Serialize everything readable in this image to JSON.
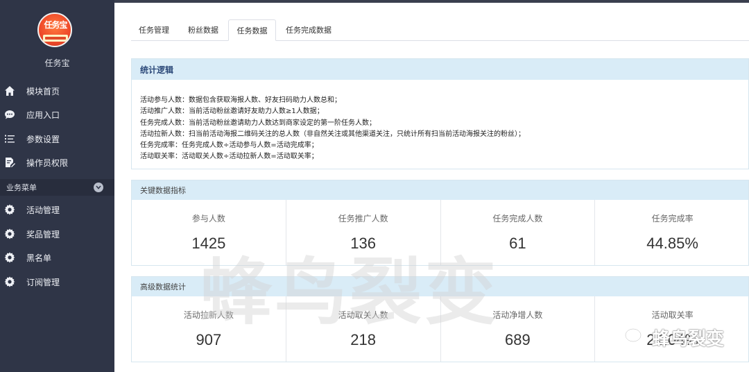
{
  "sidebar": {
    "app_name": "任务宝",
    "avatar_text": "任务宝",
    "items": [
      {
        "label": "模块首页",
        "icon": "home-icon"
      },
      {
        "label": "应用入口",
        "icon": "chat-bubble-icon"
      },
      {
        "label": "参数设置",
        "icon": "list-settings-icon"
      },
      {
        "label": "操作员权限",
        "icon": "document-edit-icon"
      }
    ],
    "section": {
      "label": "业务菜单",
      "icon": "chevron-down-icon"
    },
    "business_items": [
      {
        "label": "活动管理",
        "icon": "gear-icon"
      },
      {
        "label": "奖品管理",
        "icon": "gear-icon"
      },
      {
        "label": "黑名单",
        "icon": "gear-icon"
      },
      {
        "label": "订阅管理",
        "icon": "gear-icon"
      }
    ]
  },
  "tabs": [
    {
      "label": "任务管理",
      "active": false
    },
    {
      "label": "粉丝数据",
      "active": false
    },
    {
      "label": "任务数据",
      "active": true
    },
    {
      "label": "任务完成数据",
      "active": false
    }
  ],
  "logic": {
    "title": "统计逻辑",
    "lines": [
      "活动参与人数：数据包含获取海报人数、好友扫码助力人数总和；",
      "活动推广人数：当前活动粉丝邀请好友助力人数≥1人数据；",
      "任务完成人数：当前活动粉丝邀请助力人数达到商家设定的第一阶任务人数；",
      "活动拉新人数：扫当前活动海报二维码关注的总人数（非自然关注或其他渠道关注，只统计所有扫当前活动海报关注的粉丝）；",
      "任务完成率：任务完成人数÷活动参与人数=活动完成率；",
      "活动取关率：活动取关人数÷活动拉新人数=活动取关率；"
    ]
  },
  "key_metrics": {
    "title": "关键数据指标",
    "items": [
      {
        "label": "参与人数",
        "value": "1425"
      },
      {
        "label": "任务推广人数",
        "value": "136"
      },
      {
        "label": "任务完成人数",
        "value": "61"
      },
      {
        "label": "任务完成率",
        "value": "44.85%"
      }
    ]
  },
  "advanced_metrics": {
    "title": "高级数据统计",
    "items": [
      {
        "label": "活动拉新人数",
        "value": "907"
      },
      {
        "label": "活动取关人数",
        "value": "218"
      },
      {
        "label": "活动净增人数",
        "value": "689"
      },
      {
        "label": "活动取关率",
        "value": "24.04%"
      }
    ]
  },
  "watermark": {
    "main": "蜂鸟裂变",
    "wechat": "蜂鸟裂变"
  },
  "colors": {
    "sidebar_bg": "#2f3547",
    "panel_header_bg": "#d9ecf7",
    "accent": "#2d4a7a"
  }
}
